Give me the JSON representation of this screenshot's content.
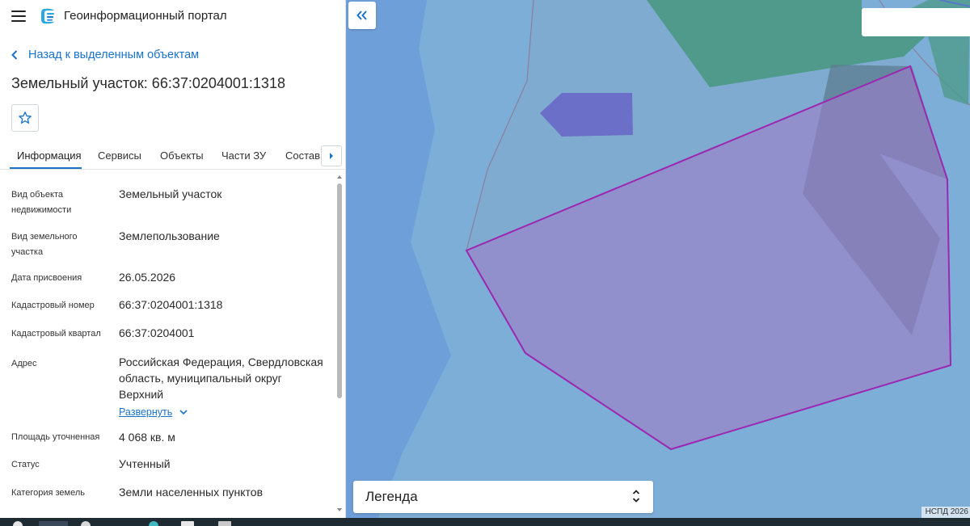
{
  "app": {
    "title": "Геоинформационный портал"
  },
  "nav": {
    "back_label": "Назад к выделенным объектам"
  },
  "parcel": {
    "title": "Земельный участок: 66:37:0204001:1318"
  },
  "tabs": [
    {
      "label": "Информация",
      "active": true
    },
    {
      "label": "Сервисы",
      "active": false
    },
    {
      "label": "Объекты",
      "active": false
    },
    {
      "label": "Части ЗУ",
      "active": false
    },
    {
      "label": "Состав",
      "active": false
    }
  ],
  "properties": [
    {
      "label": "Вид объекта недвижимости",
      "value": "Земельный участок"
    },
    {
      "label": "Вид земельного участка",
      "value": "Землепользование"
    },
    {
      "label": "Дата присвоения",
      "value": "26.05.2026"
    },
    {
      "label": "Кадастровый номер",
      "value": "66:37:0204001:1318"
    },
    {
      "label": "Кадастровый квартал",
      "value": "66:37:0204001"
    },
    {
      "label": "Адрес",
      "value": "Российская Федерация, Свердловская область, муниципальный округ Верхний"
    },
    {
      "label": "Площадь уточненная",
      "value": "4 068 кв. м"
    },
    {
      "label": "Статус",
      "value": "Учтенный"
    },
    {
      "label": "Категория земель",
      "value": "Земли населенных пунктов"
    }
  ],
  "expand_label": "Развернуть",
  "map": {
    "legend_label": "Легенда",
    "attribution": "НСПД 2026",
    "search_placeholder": ""
  },
  "colors": {
    "accent": "#1a73c9",
    "map_water": "#6f9fd8",
    "parcel_outline": "#9c27b0"
  },
  "icons": [
    "menu-icon",
    "portal-logo-icon",
    "chevron-left-icon",
    "star-icon",
    "chevron-right-icon",
    "double-chevron-left-icon",
    "chevron-down-icon",
    "unfold-icon"
  ]
}
